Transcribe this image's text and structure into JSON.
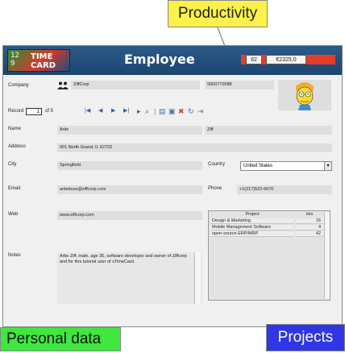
{
  "callouts": {
    "productivity": "Productivity",
    "personal_data": "Personal data",
    "projects": "Projects"
  },
  "header": {
    "logo_digits": "12 9",
    "logo_line1": "TIME",
    "logo_line2": "CARD",
    "title": "Employee",
    "count_badge": "62",
    "amount_badge": "€2325,0"
  },
  "labels": {
    "company": "Company",
    "record": "Record",
    "of": "of 5",
    "name": "Name",
    "address": "Address",
    "city": "City",
    "country": "Country",
    "email": "Email",
    "phone": "Phone",
    "web": "Web",
    "notes": "Notes"
  },
  "employee": {
    "company": "ZiffCorp",
    "company_number": "9900770088",
    "record_current": "1",
    "first_name": "Artie",
    "last_name": "Ziff",
    "address": "901 North Grand, IL 62702",
    "city": "Springfield",
    "country": "United States",
    "email": "artieboss@ziffcorp.com",
    "phone": "+1(217)522-6670",
    "web": "www.ziffcorp.com",
    "notes": "Artie Ziff, male, age 35, software developer and owner of Ziffcorp and for this tutorial user of xTimeCard."
  },
  "projects": {
    "col_project": "Project",
    "col_hrs": "Hrs",
    "rows": [
      {
        "name": "Design & Marketing",
        "hrs": "16"
      },
      {
        "name": "Mobile Management Software",
        "hrs": "4"
      },
      {
        "name": "open-source ERP/MRP",
        "hrs": "42"
      }
    ]
  },
  "nav": {
    "first": "|◀",
    "prev": "◀",
    "next": "▶",
    "last": "▶|"
  },
  "colors": {
    "header_blue": "#1d4670",
    "accent_red": "#e43e2b",
    "callout_yellow": "#fbf14a",
    "callout_green": "#3ee83e",
    "callout_blue": "#2e36e6"
  }
}
